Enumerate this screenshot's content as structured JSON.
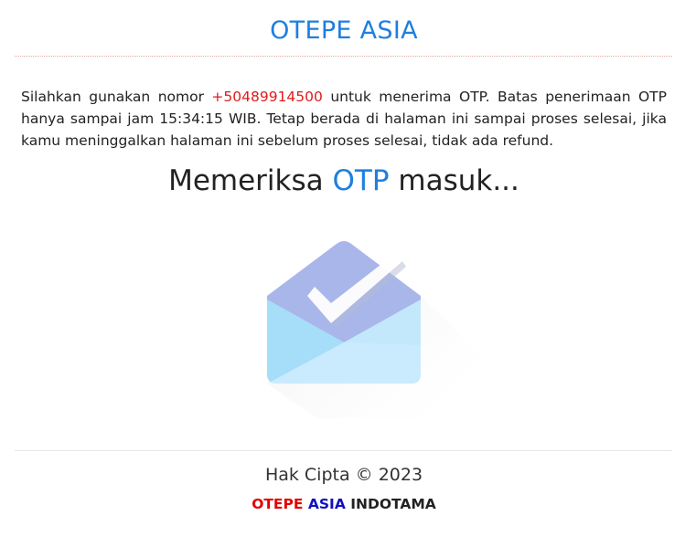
{
  "header": {
    "title": "OTEPE ASIA"
  },
  "notice": {
    "prefix": "Silahkan gunakan nomor ",
    "phone": "+50489914500",
    "suffix": " untuk menerima OTP. Batas penerimaan OTP hanya sampai jam 15:34:15 WIB. Tetap berada di halaman ini sampai proses selesai, jika kamu meninggalkan halaman ini sebelum proses selesai, tidak ada refund."
  },
  "status": {
    "before": "Memeriksa ",
    "accent": "OTP",
    "after": " masuk..."
  },
  "illustration": {
    "icon": "envelope-check-icon"
  },
  "footer": {
    "copyright": "Hak Cipta © 2023",
    "company": {
      "part1": "OTEPE",
      "part2": "ASIA",
      "part3": "INDOTAMA"
    }
  },
  "colors": {
    "brand_blue": "#1e7fe0",
    "phone_red": "#e01b1b",
    "company_red": "#e00000",
    "company_blue": "#1010c0",
    "company_dark": "#222222"
  }
}
